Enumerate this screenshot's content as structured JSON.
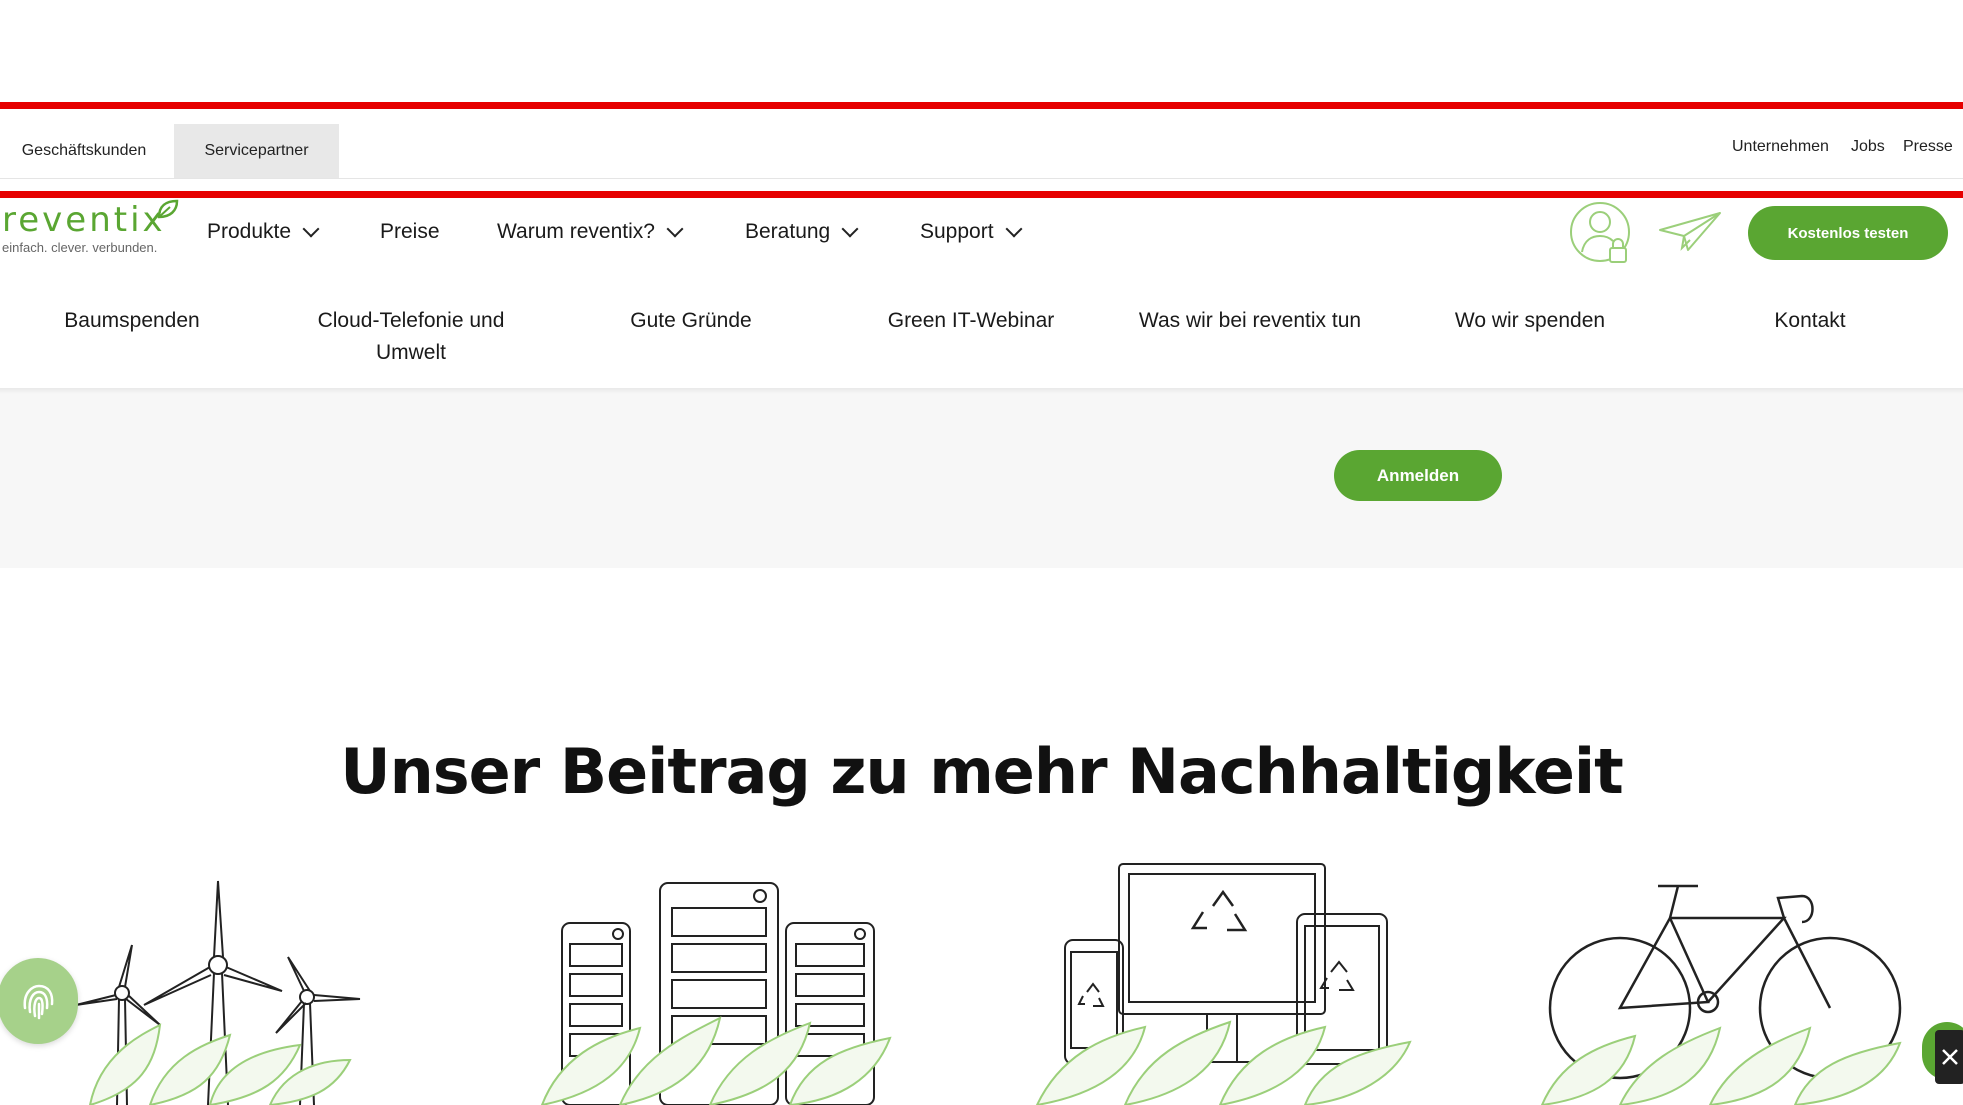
{
  "topbar": {
    "tabs": [
      "Geschäftskunden",
      "Servicepartner"
    ],
    "links": [
      "Unternehmen",
      "Jobs",
      "Presse"
    ]
  },
  "brand": {
    "logo_text": "reventix",
    "tagline": "einfach. clever. verbunden.",
    "color": "#5aa632"
  },
  "nav": {
    "items": [
      "Produkte",
      "Preise",
      "Warum reventix?",
      "Beratung",
      "Support"
    ],
    "icons": [
      "user-lock-icon",
      "paper-plane-icon"
    ],
    "cta_label": "Kostenlos testen"
  },
  "subnav": {
    "items": [
      "Baumspenden",
      "Cloud-Telefonie und Umwelt",
      "Gute Gründe",
      "Green IT-Webinar",
      "Was wir bei reventix tun",
      "Wo wir spenden",
      "Kontakt"
    ]
  },
  "band": {
    "button_label": "Anmelden"
  },
  "section": {
    "title": "Unser Beitrag zu mehr Nachhaltigkeit",
    "illustrations": [
      "wind-turbines-icon",
      "servers-icon",
      "devices-recycling-icon",
      "bicycle-icon"
    ]
  },
  "widgets": [
    "fingerprint-icon",
    "expand-icon"
  ]
}
